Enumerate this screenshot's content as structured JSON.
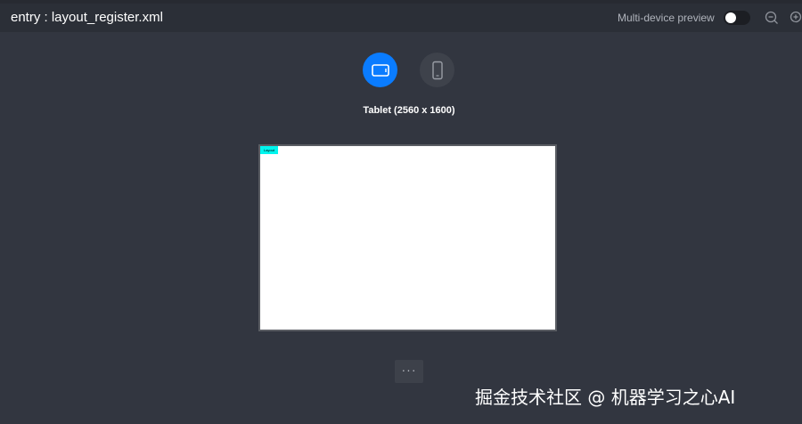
{
  "header": {
    "title": "entry : layout_register.xml",
    "multi_device_label": "Multi-device preview",
    "multi_device_enabled": false
  },
  "device_selector": {
    "selected_label": "Tablet (2560 x 1600)",
    "devices": [
      {
        "name": "tablet-icon",
        "selected": true
      },
      {
        "name": "phone-icon",
        "selected": false
      }
    ]
  },
  "canvas": {
    "layout_tag": "Layout"
  },
  "more_button": "···",
  "watermark": "掘金技术社区 @ 机器学习之心AI",
  "colors": {
    "background": "#323640",
    "header": "#2b2f37",
    "accent": "#0a7cff",
    "layout_tag": "#00f5ee"
  }
}
